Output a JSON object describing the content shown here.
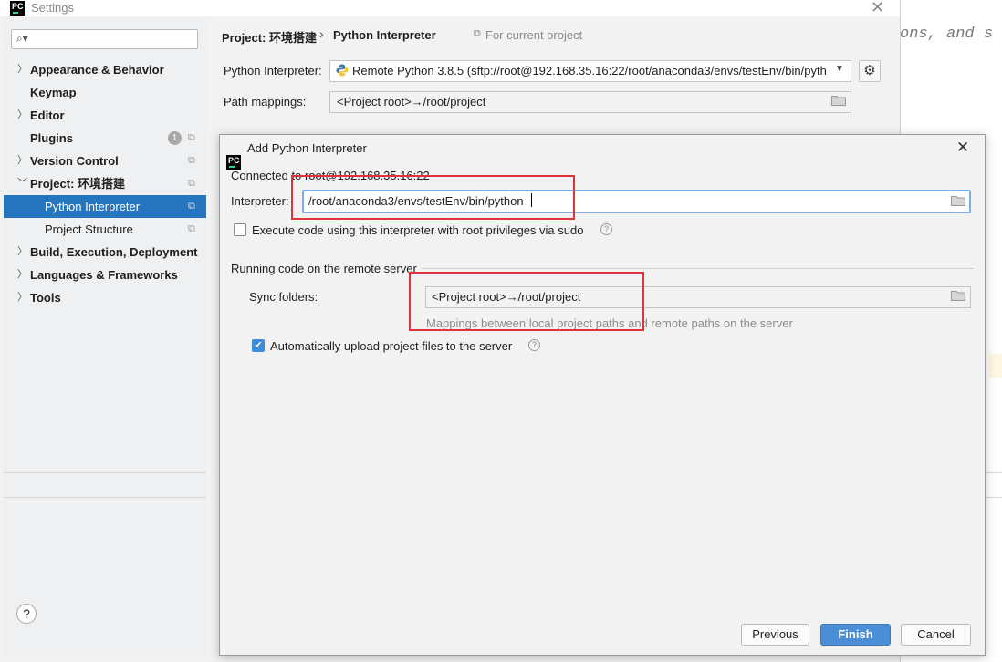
{
  "background_editor": {
    "code_text": "ons, and s"
  },
  "window": {
    "title": "Settings",
    "logo": "PC"
  },
  "search": {
    "placeholder": ""
  },
  "sidebar": {
    "items": [
      {
        "label": "Appearance & Behavior",
        "icon": "chevron-right-icon"
      },
      {
        "label": "Keymap"
      },
      {
        "label": "Editor",
        "icon": "chevron-right-icon"
      },
      {
        "label": "Plugins",
        "badge": "1"
      },
      {
        "label": "Version Control",
        "icon": "chevron-right-icon"
      },
      {
        "label": "Project: 环境搭建",
        "icon": "chevron-down-icon"
      },
      {
        "label": "Python Interpreter",
        "selected": true
      },
      {
        "label": "Project Structure"
      },
      {
        "label": "Build, Execution, Deployment",
        "icon": "chevron-right-icon"
      },
      {
        "label": "Languages & Frameworks",
        "icon": "chevron-right-icon"
      },
      {
        "label": "Tools",
        "icon": "chevron-right-icon"
      }
    ],
    "help": "?"
  },
  "breadcrumb": {
    "project": "Project: 环境搭建",
    "separator": "›",
    "current": "Python Interpreter",
    "scope": "For current project"
  },
  "settings_form": {
    "interpreter_label": "Python Interpreter:",
    "interpreter_value": "Remote Python 3.8.5 (sftp://root@192.168.35.16:22/root/anaconda3/envs/testEnv/bin/pyth",
    "path_mappings_label": "Path mappings:",
    "path_mappings_value": "<Project root>→/root/project"
  },
  "dialog": {
    "title": "Add Python Interpreter",
    "logo": "PC",
    "connected": "Connected to root@192.168.35.16:22",
    "interpreter_label": "Interpreter:",
    "interpreter_value": "/root/anaconda3/envs/testEnv/bin/python",
    "sudo_label": "Execute code using this interpreter with root privileges via sudo",
    "sudo_checked": false,
    "remote_heading": "Running code on the remote server",
    "sync_label": "Sync folders:",
    "sync_value": "<Project root>→/root/project",
    "sync_hint": "Mappings between local project paths and remote paths on the server",
    "upload_label": "Automatically upload project files to the server",
    "upload_checked": true,
    "buttons": {
      "previous": "Previous",
      "finish": "Finish",
      "cancel": "Cancel"
    }
  },
  "colors": {
    "accent": "#2675bf",
    "finish_button": "#4a8fd6",
    "annotation_red": "#e0343b"
  }
}
